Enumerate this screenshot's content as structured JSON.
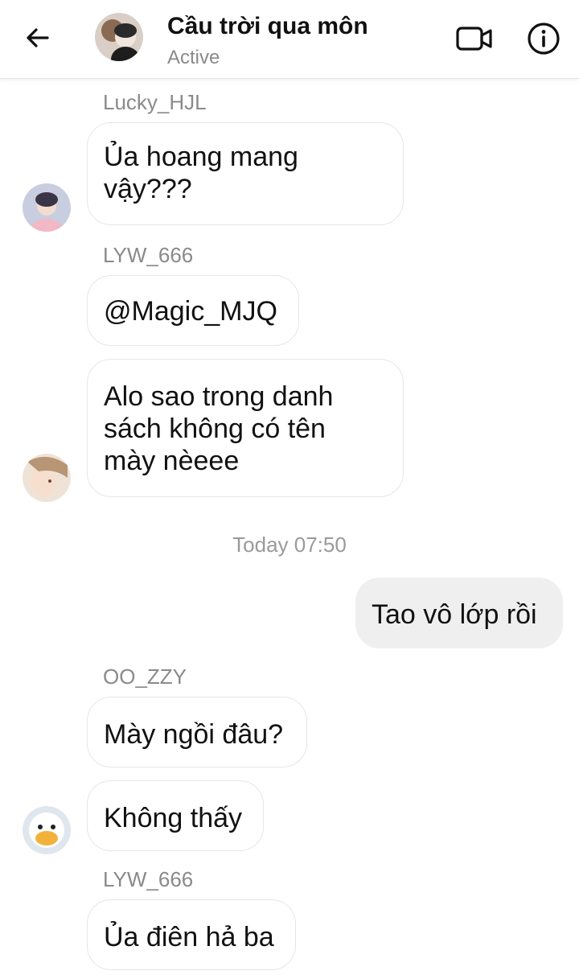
{
  "header": {
    "title": "Cầu trời qua môn",
    "status": "Active"
  },
  "icons": {
    "back": "arrow-left-icon",
    "video": "video-camera-icon",
    "info": "info-circle-icon"
  },
  "messages": [
    {
      "sender": "Lucky_HJL",
      "text_lines": [
        "Ủa hoang mang",
        "vậy???"
      ]
    },
    {
      "sender": "LYW_666",
      "text_lines": [
        "@Magic_MJQ"
      ]
    },
    {
      "text_lines": [
        "Alo sao trong danh",
        "sách không có tên",
        "mày nèeee"
      ]
    },
    {
      "timestamp": "Today 07:50"
    },
    {
      "self": true,
      "text_lines": [
        "Tao vô lớp rồi"
      ]
    },
    {
      "sender": "OO_ZZY",
      "text_lines": [
        "Mày ngồi đâu?"
      ]
    },
    {
      "text_lines": [
        "Không thấy"
      ]
    },
    {
      "sender": "LYW_666",
      "text_lines": [
        "Ủa điên hả ba"
      ]
    }
  ]
}
